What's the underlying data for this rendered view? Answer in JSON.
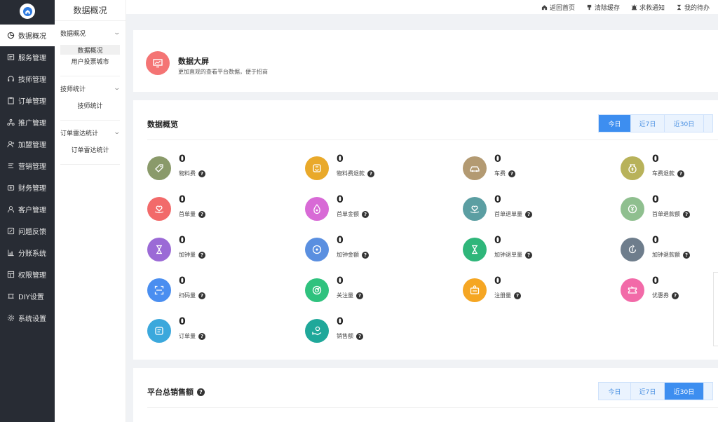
{
  "sidebar": {
    "items": [
      {
        "label": "数据概况",
        "icon": "pie-icon"
      },
      {
        "label": "服务管理",
        "icon": "service-icon"
      },
      {
        "label": "技师管理",
        "icon": "headset-icon"
      },
      {
        "label": "订单管理",
        "icon": "clipboard-icon"
      },
      {
        "label": "推广管理",
        "icon": "network-icon"
      },
      {
        "label": "加盟管理",
        "icon": "user-add-icon"
      },
      {
        "label": "营销管理",
        "icon": "marketing-icon"
      },
      {
        "label": "财务管理",
        "icon": "wallet-icon"
      },
      {
        "label": "客户管理",
        "icon": "user-icon"
      },
      {
        "label": "问题反馈",
        "icon": "feedback-icon"
      },
      {
        "label": "分账系统",
        "icon": "bar-chart-icon"
      },
      {
        "label": "权限管理",
        "icon": "key-box-icon"
      },
      {
        "label": "DIY设置",
        "icon": "diy-icon"
      },
      {
        "label": "系统设置",
        "icon": "gear-icon"
      }
    ]
  },
  "subnav": {
    "title": "数据概况",
    "groups": [
      {
        "label": "数据概况",
        "links": [
          "数据概况",
          "用户投票城市"
        ]
      },
      {
        "label": "技师统计",
        "links": [
          "技师统计"
        ]
      },
      {
        "label": "订单雷达统计",
        "links": [
          "订单雷达统计"
        ]
      }
    ]
  },
  "header": {
    "links": [
      "返回首页",
      "清除缓存",
      "求救通知",
      "我的待办"
    ]
  },
  "screen": {
    "title": "数据大屏",
    "desc": "更加直观的查看平台数据，便于招商"
  },
  "overview": {
    "title": "数据概览",
    "tabs": [
      "今日",
      "近7日",
      "近30日"
    ],
    "stats": [
      {
        "value": "0",
        "label": "物料费",
        "color": "#8a9a6a",
        "icon": "tag-icon"
      },
      {
        "value": "0",
        "label": "物料费退款",
        "color": "#e9a92a",
        "icon": "refund-box-icon"
      },
      {
        "value": "0",
        "label": "车费",
        "color": "#b39a72",
        "icon": "car-icon"
      },
      {
        "value": "0",
        "label": "车费退款",
        "color": "#b8b25a",
        "icon": "money-bag-icon"
      },
      {
        "value": "0",
        "label": "首单量",
        "color": "#f26a6a",
        "icon": "heart-hand-icon"
      },
      {
        "value": "0",
        "label": "首单金额",
        "color": "#d86ad6",
        "icon": "drop-icon"
      },
      {
        "value": "0",
        "label": "首单退单量",
        "color": "#5b9ea2",
        "icon": "heart-hand-icon"
      },
      {
        "value": "0",
        "label": "首单退款额",
        "color": "#8fbf8f",
        "icon": "yuan-circle-icon"
      },
      {
        "value": "0",
        "label": "加钟量",
        "color": "#9b6ad6",
        "icon": "hourglass-icon"
      },
      {
        "value": "0",
        "label": "加钟金额",
        "color": "#5a8fe0",
        "icon": "coin-icon"
      },
      {
        "value": "0",
        "label": "加钟退单量",
        "color": "#2fb67a",
        "icon": "hourglass-icon"
      },
      {
        "value": "0",
        "label": "加钟退款额",
        "color": "#6e7d8c",
        "icon": "refund-coin-icon"
      },
      {
        "value": "0",
        "label": "扫码量",
        "color": "#4a8ef0",
        "icon": "scan-icon"
      },
      {
        "value": "0",
        "label": "关注量",
        "color": "#2fc27e",
        "icon": "target-icon"
      },
      {
        "value": "0",
        "label": "注册量",
        "color": "#f5a623",
        "icon": "register-icon"
      },
      {
        "value": "0",
        "label": "优惠券",
        "color": "#f26aa8",
        "icon": "coupon-icon"
      },
      {
        "value": "0",
        "label": "订单量",
        "color": "#3ba8dc",
        "icon": "order-icon"
      },
      {
        "value": "0",
        "label": "销售额",
        "color": "#1fa89a",
        "icon": "money-hand-icon"
      }
    ]
  },
  "sales": {
    "title": "平台总销售额",
    "tabs": [
      "今日",
      "近7日",
      "近30日"
    ]
  }
}
